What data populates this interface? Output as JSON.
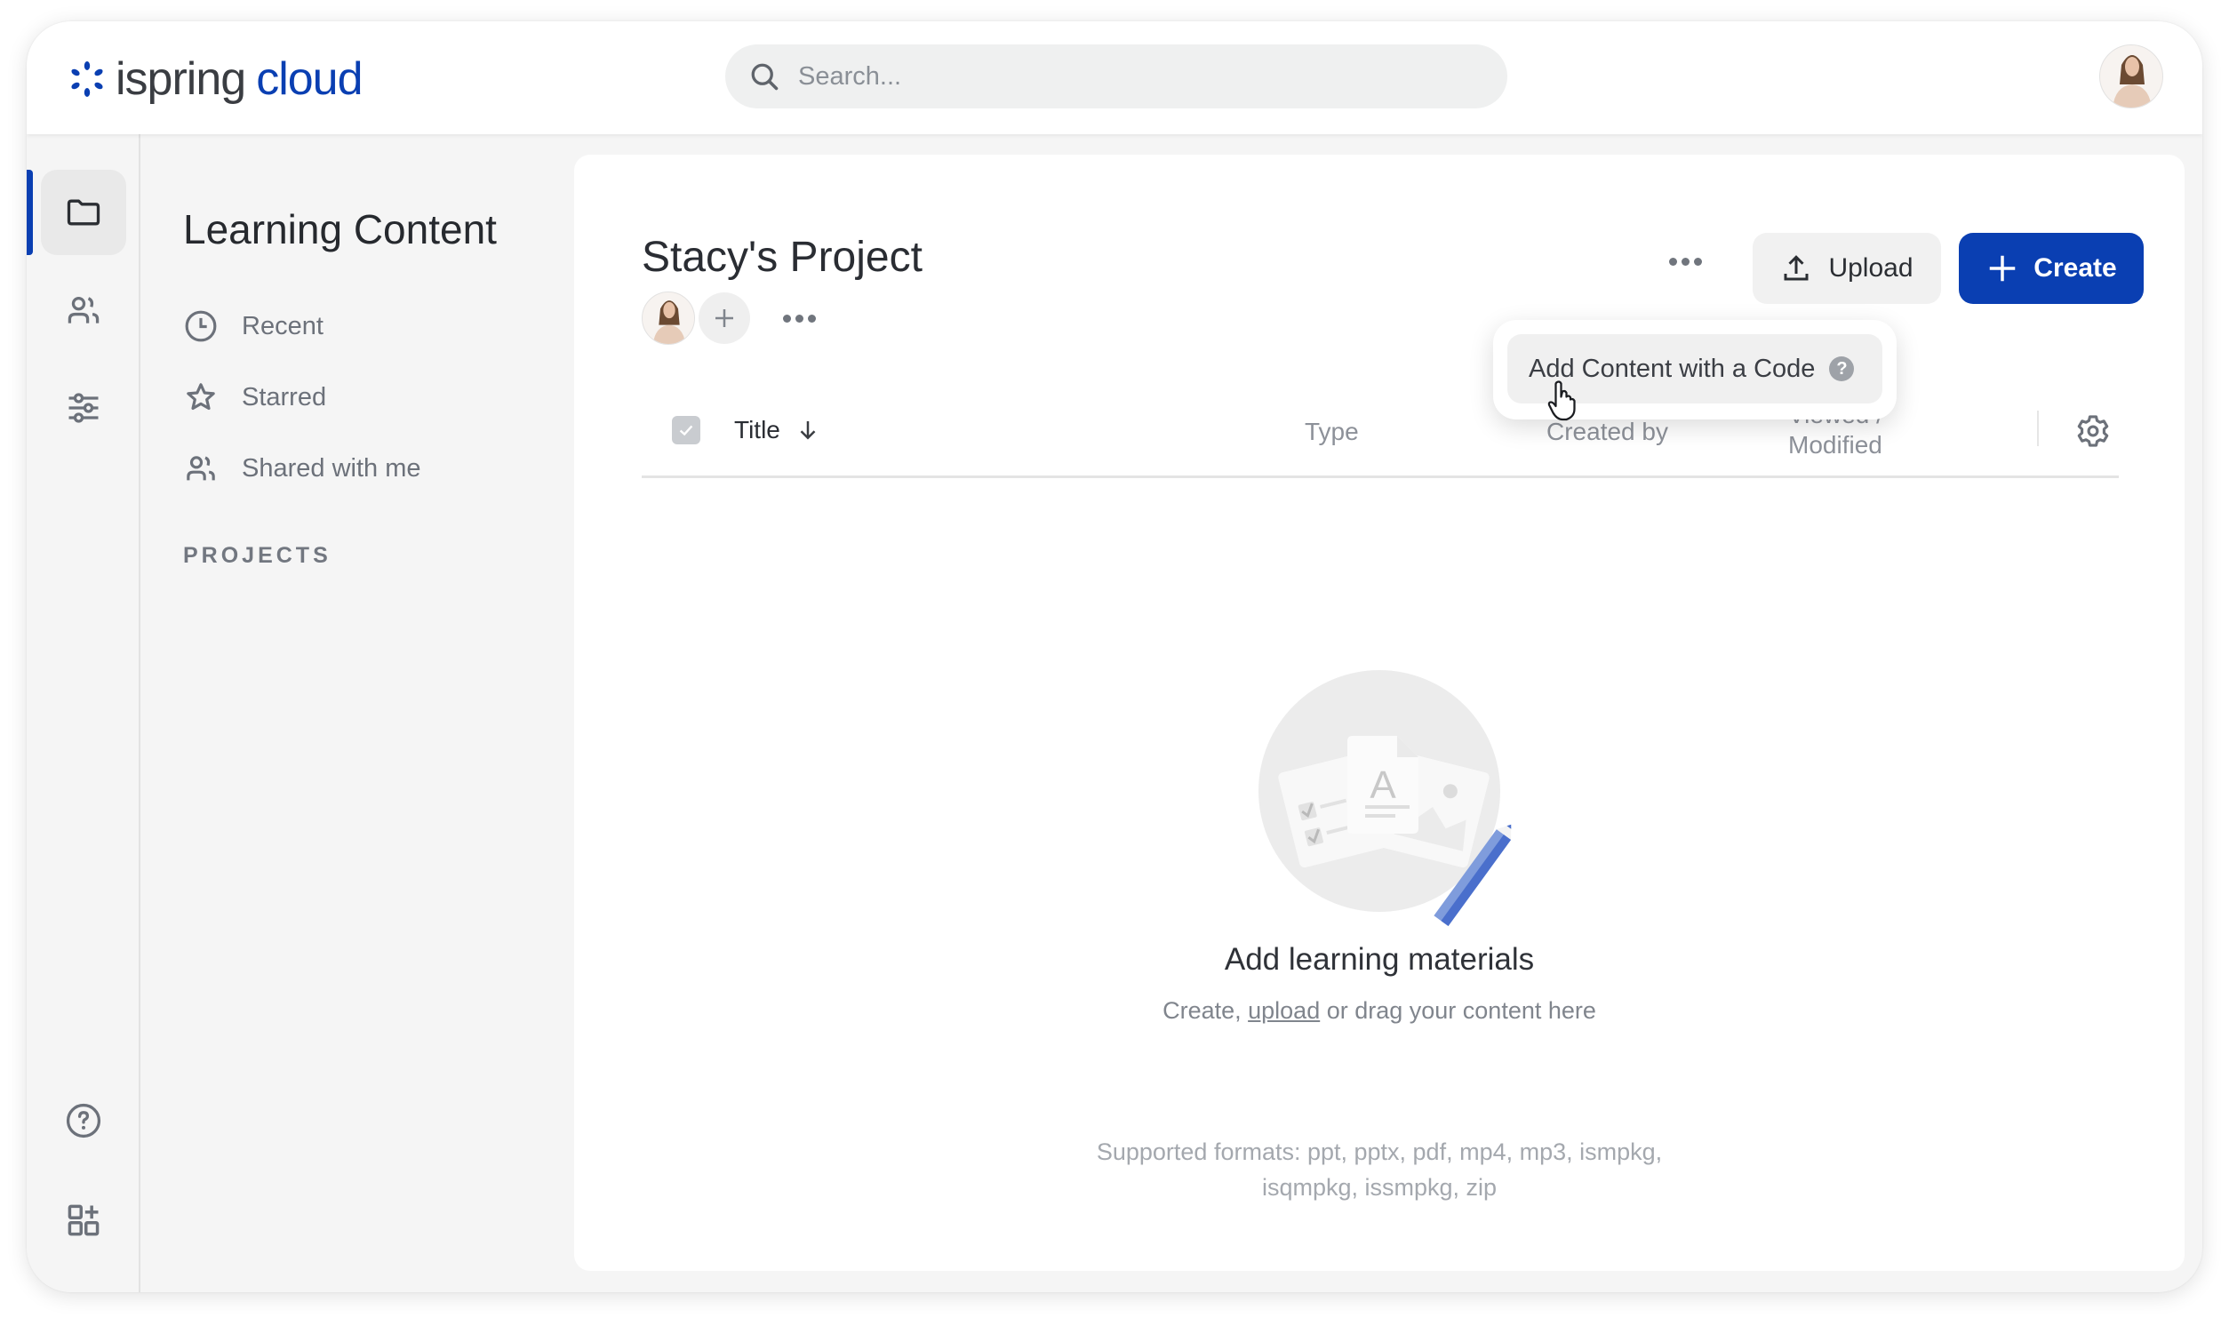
{
  "app": {
    "brand_word1": "ispring",
    "brand_word2": "cloud",
    "brand_color": "#0a3fb2"
  },
  "header": {
    "search": {
      "placeholder": "Search...",
      "value": "",
      "icon": "search-icon"
    },
    "user_avatar": "avatar"
  },
  "rail": {
    "items": [
      {
        "name": "content",
        "icon": "folder-icon",
        "active": true
      },
      {
        "name": "users",
        "icon": "users-icon",
        "active": false
      },
      {
        "name": "settings",
        "icon": "sliders-icon",
        "active": false
      }
    ],
    "bottom_items": [
      {
        "name": "help",
        "icon": "help-circle-icon"
      },
      {
        "name": "apps",
        "icon": "add-widget-icon"
      }
    ]
  },
  "sidebar": {
    "title": "Learning Content",
    "items": [
      {
        "label": "Recent",
        "icon": "clock-icon"
      },
      {
        "label": "Starred",
        "icon": "star-icon"
      },
      {
        "label": "Shared with me",
        "icon": "users-icon"
      }
    ],
    "projects_label": "PROJECTS"
  },
  "main": {
    "project_title": "Stacy's Project",
    "upload_label": "Upload",
    "create_label": "Create",
    "dropdown": {
      "items": [
        {
          "label": "Add Content with a Code",
          "help": "?"
        }
      ]
    },
    "table": {
      "columns": {
        "title": "Title",
        "type": "Type",
        "created_by": "Created by",
        "viewed_line1": "Viewed /",
        "viewed_line2": "Modified"
      },
      "sort": "title-desc"
    },
    "empty": {
      "title": "Add learning materials",
      "sub_prefix": "Create, ",
      "sub_link": "upload",
      "sub_suffix": " or drag your content here",
      "formats_line1": "Supported formats: ppt, pptx, pdf, mp4, mp3, ismpkg,",
      "formats_line2": "isqmpkg, issmpkg, zip"
    }
  }
}
